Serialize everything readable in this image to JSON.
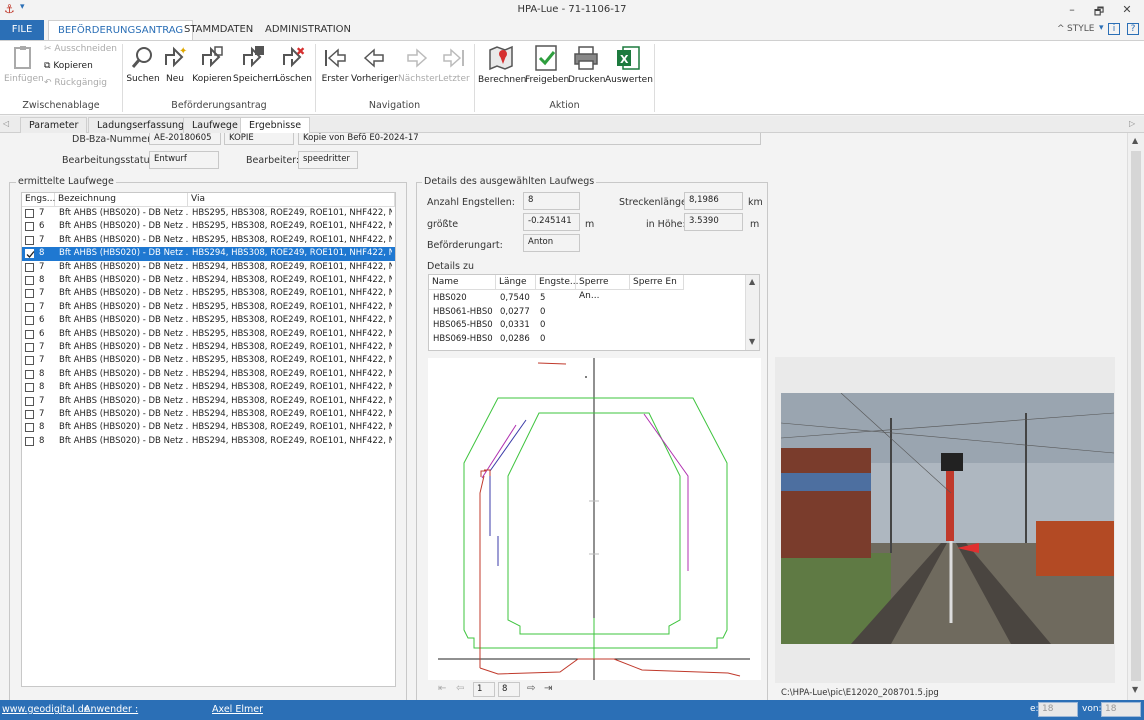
{
  "window": {
    "title": "HPA-Lue - 71-1106-17",
    "minimize": "–",
    "restore": "🗗",
    "close": "✕"
  },
  "ribbon_tabs": {
    "file": "FILE",
    "tab1": "BEFÖRDERUNGSANTRAG",
    "tab2": "STAMMDATEN",
    "tab3": "ADMINISTRATION",
    "style": "STYLE"
  },
  "ribbon": {
    "clipboard": {
      "paste": "Einfügen",
      "cut": "Ausschneiden",
      "copy": "Kopieren",
      "undo": "Rückgängig",
      "group": "Zwischenablage"
    },
    "order": {
      "search": "Suchen",
      "new": "Neu",
      "copy": "Kopieren",
      "save": "Speichern",
      "delete": "Löschen",
      "group": "Beförderungsantrag"
    },
    "navigation": {
      "first": "Erster",
      "prev": "Vorheriger",
      "next": "Nächster",
      "last": "Letzter",
      "group": "Navigation"
    },
    "action": {
      "calc": "Berechnen",
      "release": "Freigeben",
      "print": "Drucken",
      "eval": "Auswerten",
      "group": "Aktion"
    }
  },
  "subtabs": [
    "Parameter",
    "Ladungserfassung",
    "Laufwege",
    "Ergebnisse"
  ],
  "form": {
    "db_nr_label": "DB-Bza-Nummer:",
    "db_nr_value": "AE-20180605",
    "kopie": "KOPIE",
    "desc": "Kopie von Befö E0-2024-17",
    "status_label": "Bearbeitungsstatus:",
    "status_value": "Entwurf",
    "editor_label": "Bearbeiter:",
    "editor_value": "speedritter"
  },
  "routes": {
    "legend": "ermittelte Laufwege",
    "headers": [
      "Engs...",
      "Bezeichnung",
      "Via"
    ],
    "rows": [
      {
        "checked": false,
        "n": "7",
        "name": "Bft AHBS (HBS020) - DB Netz ...",
        "via": "HBS295, HBS308, ROE249, ROE101, NHF422, N..."
      },
      {
        "checked": false,
        "n": "6",
        "name": "Bft AHBS (HBS020) - DB Netz ...",
        "via": "HBS295, HBS308, ROE249, ROE101, NHF422, N..."
      },
      {
        "checked": false,
        "n": "7",
        "name": "Bft AHBS (HBS020) - DB Netz ...",
        "via": "HBS295, HBS308, ROE249, ROE101, NHF422, N..."
      },
      {
        "checked": true,
        "n": "8",
        "name": "Bft AHBS (HBS020) - DB Netz ...",
        "via": "HBS294, HBS308, ROE249, ROE101, NHF422, N..."
      },
      {
        "checked": false,
        "n": "7",
        "name": "Bft AHBS (HBS020) - DB Netz ...",
        "via": "HBS294, HBS308, ROE249, ROE101, NHF422, N..."
      },
      {
        "checked": false,
        "n": "8",
        "name": "Bft AHBS (HBS020) - DB Netz ...",
        "via": "HBS294, HBS308, ROE249, ROE101, NHF422, N..."
      },
      {
        "checked": false,
        "n": "7",
        "name": "Bft AHBS (HBS020) - DB Netz ...",
        "via": "HBS295, HBS308, ROE249, ROE101, NHF422, N..."
      },
      {
        "checked": false,
        "n": "7",
        "name": "Bft AHBS (HBS020) - DB Netz ...",
        "via": "HBS295, HBS308, ROE249, ROE101, NHF422, N..."
      },
      {
        "checked": false,
        "n": "6",
        "name": "Bft AHBS (HBS020) - DB Netz ...",
        "via": "HBS295, HBS308, ROE249, ROE101, NHF422, N..."
      },
      {
        "checked": false,
        "n": "6",
        "name": "Bft AHBS (HBS020) - DB Netz ...",
        "via": "HBS295, HBS308, ROE249, ROE101, NHF422, N..."
      },
      {
        "checked": false,
        "n": "7",
        "name": "Bft AHBS (HBS020) - DB Netz ...",
        "via": "HBS294, HBS308, ROE249, ROE101, NHF422, N..."
      },
      {
        "checked": false,
        "n": "7",
        "name": "Bft AHBS (HBS020) - DB Netz ...",
        "via": "HBS295, HBS308, ROE249, ROE101, NHF422, N..."
      },
      {
        "checked": false,
        "n": "8",
        "name": "Bft AHBS (HBS020) - DB Netz ...",
        "via": "HBS294, HBS308, ROE249, ROE101, NHF422, N..."
      },
      {
        "checked": false,
        "n": "8",
        "name": "Bft AHBS (HBS020) - DB Netz ...",
        "via": "HBS294, HBS308, ROE249, ROE101, NHF422, N..."
      },
      {
        "checked": false,
        "n": "7",
        "name": "Bft AHBS (HBS020) - DB Netz ...",
        "via": "HBS294, HBS308, ROE249, ROE101, NHF422, N..."
      },
      {
        "checked": false,
        "n": "7",
        "name": "Bft AHBS (HBS020) - DB Netz ...",
        "via": "HBS294, HBS308, ROE249, ROE101, NHF422, N..."
      },
      {
        "checked": false,
        "n": "8",
        "name": "Bft AHBS (HBS020) - DB Netz ...",
        "via": "HBS294, HBS308, ROE249, ROE101, NHF422, N..."
      },
      {
        "checked": false,
        "n": "8",
        "name": "Bft AHBS (HBS020) - DB Netz ...",
        "via": "HBS294, HBS308, ROE249, ROE101, NHF422, N..."
      }
    ]
  },
  "details": {
    "legend": "Details des ausgewählten Laufwegs",
    "count_label": "Anzahl Engstellen:",
    "count_value": "8",
    "length_label": "Streckenlänge:",
    "length_value": "8,1986",
    "length_unit": "km",
    "max_label": "größte",
    "max_value": "-0.245141",
    "max_unit": "m",
    "height_label": "in Höhe:",
    "height_value": "3.5390",
    "height_unit": "m",
    "type_label": "Beförderungart:",
    "type_value": "Anton",
    "details_label": "Details zu",
    "headers": [
      "Name",
      "Länge",
      "Engste...",
      "Sperre An...",
      "Sperre En"
    ],
    "rows": [
      {
        "name": "HBS020",
        "len": "0,7540",
        "eng": "5"
      },
      {
        "name": "HBS061-HBS0",
        "len": "0,0277",
        "eng": "0"
      },
      {
        "name": "HBS065-HBS0",
        "len": "0,0331",
        "eng": "0"
      },
      {
        "name": "HBS069-HBS0",
        "len": "0,0286",
        "eng": "0"
      }
    ]
  },
  "pager": {
    "current": "1",
    "total": "8"
  },
  "photo_path": "C:\\HPA-Lue\\pic\\E12020_208701.5.jpg",
  "status": {
    "website": "www.geodigital.de",
    "user_label": "Anwender :",
    "user_value": "Axel Elmer",
    "e_value": "18",
    "von_label": "von:",
    "von_value": "18"
  },
  "colors": {
    "accent": "#2b6fb6",
    "selection": "#1f78d1",
    "profile_green": "#3ec43e",
    "profile_red": "#c0392b",
    "profile_blue": "#3b3ba8",
    "profile_purple": "#b030b0"
  }
}
